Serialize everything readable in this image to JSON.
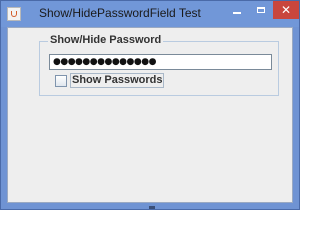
{
  "window": {
    "title": "Show/HidePasswordField Test",
    "icon": "java-cup-icon",
    "controls": {
      "minimize": "minimize-icon",
      "maximize": "maximize-icon",
      "close": "close-icon",
      "close_glyph": "✕"
    }
  },
  "panel": {
    "group_title": "Show/Hide Password",
    "password_value": "●●●●●●●●●●●●●●",
    "checkbox_label": "Show Passwords",
    "checkbox_checked": false
  },
  "colors": {
    "titlebar": "#7197d8",
    "close_button": "#c9463d",
    "client_background": "#eeeeee"
  }
}
